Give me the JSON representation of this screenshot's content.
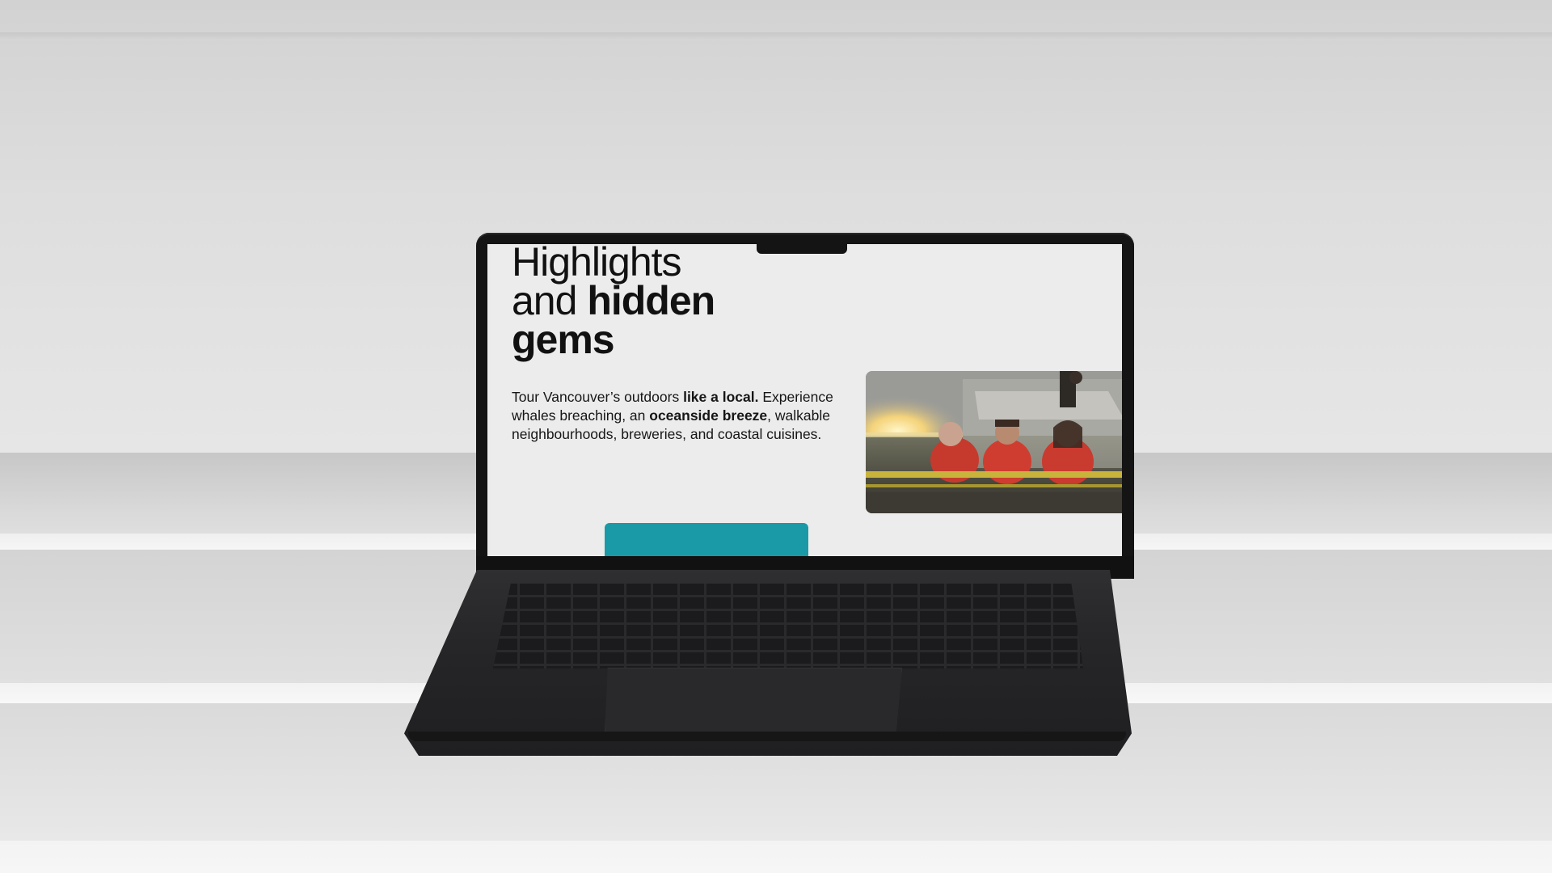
{
  "page": {
    "headline_line1": "Highlights",
    "headline_line2_regular": "and ",
    "headline_line2_bold": "hidden",
    "headline_line3_bold": "gems",
    "intro": {
      "part1": "Tour Vancouver’s outdoors ",
      "part2_bold": "like a local.",
      "part3": " Experience whales breaching, an ",
      "part4_bold": "oceanside breeze",
      "part5": ", walkable neighbourhoods, breweries, and coastal cuisines."
    },
    "photo_description": "Group of people in red jackets on a boat at sunset",
    "cta_color": "#1a9aa6"
  },
  "device": {
    "type": "laptop",
    "color": "#141414"
  },
  "colors": {
    "screen_bg": "#ececec",
    "text": "#111111",
    "accent": "#1a9aa6"
  }
}
